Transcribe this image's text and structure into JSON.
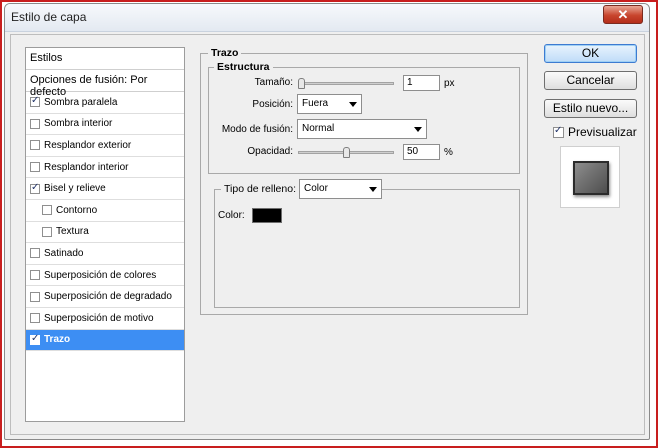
{
  "window": {
    "title": "Estilo de capa",
    "close_glyph": "✕"
  },
  "style_list": {
    "header": "Estilos",
    "blending_options": "Opciones de fusión: Por defecto",
    "items": [
      {
        "label": "Sombra paralela",
        "checked": true
      },
      {
        "label": "Sombra interior",
        "checked": false
      },
      {
        "label": "Resplandor exterior",
        "checked": false
      },
      {
        "label": "Resplandor interior",
        "checked": false
      },
      {
        "label": "Bisel y relieve",
        "checked": true
      },
      {
        "label": "Contorno",
        "checked": false
      },
      {
        "label": "Textura",
        "checked": false
      },
      {
        "label": "Satinado",
        "checked": false
      },
      {
        "label": "Superposición de colores",
        "checked": false
      },
      {
        "label": "Superposición de degradado",
        "checked": false
      },
      {
        "label": "Superposición de motivo",
        "checked": false
      },
      {
        "label": "Trazo",
        "checked": true
      }
    ],
    "selected_item": "Trazo"
  },
  "stroke": {
    "title": "Trazo",
    "structure": {
      "title": "Estructura",
      "size_label": "Tamaño:",
      "size_value": "1",
      "size_unit": "px",
      "size_slider_fraction": 0.0,
      "position_label": "Posición:",
      "position_value": "Fuera",
      "blend_mode_label": "Modo de fusión:",
      "blend_mode_value": "Normal",
      "opacity_label": "Opacidad:",
      "opacity_value": "50",
      "opacity_unit": "%",
      "opacity_slider_fraction": 0.5
    },
    "fill": {
      "fill_type_label": "Tipo de relleno:",
      "fill_type_value": "Color",
      "color_label": "Color:",
      "color_value": "#000000"
    }
  },
  "buttons": {
    "ok": "OK",
    "cancel": "Cancelar",
    "new_style": "Estilo nuevo...",
    "preview_label": "Previsualizar",
    "preview_checked": true
  },
  "colors": {
    "selection": "#3d8ef3",
    "window_bg": "#efefef",
    "frame_red": "#c81e1e"
  }
}
